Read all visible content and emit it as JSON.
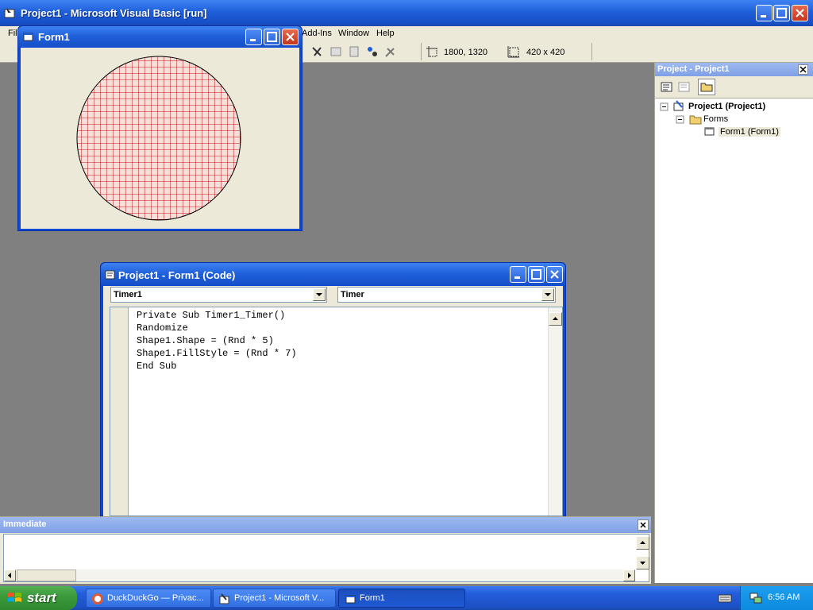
{
  "window": {
    "title": "Project1 - Microsoft Visual Basic [run]"
  },
  "menu": {
    "items": [
      "File",
      "Add-Ins",
      "Window",
      "Help"
    ]
  },
  "toolbar": {
    "position": "1800, 1320",
    "size": "420 x 420"
  },
  "form1": {
    "title": "Form1"
  },
  "code_window": {
    "title": "Project1 - Form1 (Code)",
    "object": "Timer1",
    "procedure": "Timer",
    "lines": [
      "Private Sub Timer1_Timer()",
      "Randomize",
      "Shape1.Shape = (Rnd * 5)",
      "Shape1.FillStyle = (Rnd * 7)",
      "End Sub"
    ]
  },
  "immediate": {
    "title": "Immediate"
  },
  "project": {
    "title": "Project - Project1",
    "tree": {
      "root": "Project1 (Project1)",
      "folder": "Forms",
      "item": "Form1 (Form1)"
    }
  },
  "taskbar": {
    "start": "start",
    "tasks": [
      "DuckDuckGo — Privac...",
      "Project1 - Microsoft V...",
      "Form1"
    ],
    "clock": "6:56 AM"
  },
  "colors": {
    "xp_blue": "#245edb",
    "shape_fill": "#cc0000",
    "form_bg": "#ece9d8"
  }
}
